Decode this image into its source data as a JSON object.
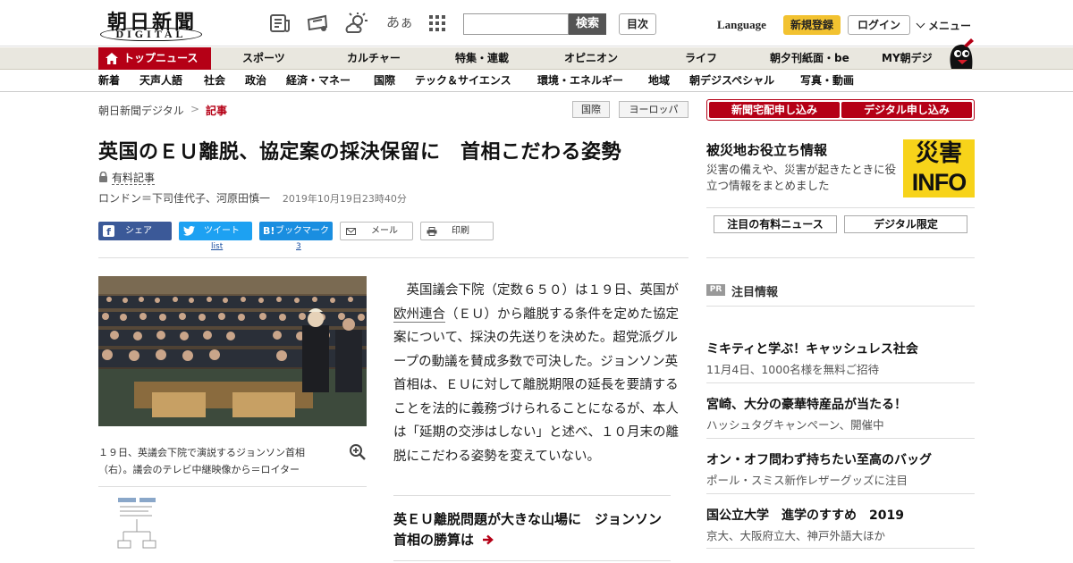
{
  "header": {
    "logo_main": "朝日新聞",
    "logo_sub": "DIGITAL",
    "font_size_label": "あぁ",
    "search_button": "検索",
    "toc_button": "目次",
    "language": "Language",
    "register": "新規登録",
    "login": "ログイン",
    "menu": "メニュー"
  },
  "nav_primary": {
    "active": "トップニュース",
    "items": [
      "スポーツ",
      "カルチャー",
      "特集・連載",
      "オピニオン",
      "ライフ",
      "朝夕刊紙面・be",
      "MY朝デジ"
    ]
  },
  "nav_secondary": {
    "items": [
      "新着",
      "天声人語",
      "社会",
      "政治",
      "経済・マネー",
      "国際",
      "テック＆サイエンス",
      "環境・エネルギー",
      "地域",
      "朝デジスペシャル",
      "写真・動画"
    ]
  },
  "breadcrumb": {
    "home": "朝日新聞デジタル",
    "separator": ">",
    "current": "記事"
  },
  "tags": [
    "国際",
    "ヨーロッパ"
  ],
  "article": {
    "title": "英国のＥＵ離脱、協定案の採決保留に　首相こだわる姿勢",
    "paid_label": "有料記事",
    "byline": "ロンドン＝下司佳代子、河原田慎一",
    "timestamp": "2019年10月19日23時40分",
    "share": {
      "facebook": "シェア",
      "twitter": "ツイート",
      "twitter_count": "list",
      "hatena": "ブックマーク",
      "hatena_count": "3",
      "mail": "メール",
      "print": "印刷"
    },
    "photo_caption": "１９日、英議会下院で演説するジョンソン首相（右）。議会のテレビ中継映像から＝ロイター",
    "body_before_link": "英国議会下院（定数６５０）は１９日、英国が",
    "body_link": "欧州連合",
    "body_after_link": "（ＥＵ）から離脱する条件を定めた協定案について、採決の先送りを決めた。超党派グループの動議を賛成多数で可決した。ジョンソン英首相は、ＥＵに対して離脱期限の延長を要請することを法的に義務づけられることになるが、本人は「延期の交渉はしない」と述べ、１０月末の離脱にこだわる姿勢を変えていない。",
    "related_title": "英ＥＵ離脱問題が大きな山場に　ジョンソン首相の勝算は"
  },
  "sidebar": {
    "delivery_button": "新聞宅配申し込み",
    "digital_button": "デジタル申し込み",
    "disaster_title": "被災地お役立ち情報",
    "disaster_desc": "災害の備えや、災害が起きたときに役立つ情報をまとめました",
    "disaster_banner_top": "災害",
    "disaster_banner_bottom": "INFO",
    "paid_news_button": "注目の有料ニュース",
    "digital_only_button": "デジタル限定",
    "pr_badge": "PR",
    "pr_heading": "注目情報",
    "pr_items": [
      {
        "title": "ミキティと学ぶ！キャッシュレス社会",
        "sub": "11月4日、1000名様を無料ご招待"
      },
      {
        "title": "宮崎、大分の豪華特産品が当たる！",
        "sub": "ハッシュタグキャンペーン、開催中"
      },
      {
        "title": "オン・オフ問わず持ちたい至高のバッグ",
        "sub": "ポール・スミス新作レザーグッズに注目"
      },
      {
        "title": "国公立大学　進学のすすめ　2019",
        "sub": "京大、大阪府立大、神戸外語大ほか"
      }
    ]
  },
  "colors": {
    "brand_red": "#b50016",
    "nav_bg": "#e9e7df",
    "facebook": "#3b5998",
    "twitter": "#1da1f2",
    "hatena": "#1a8ee0",
    "register_yellow": "#f2c230",
    "disaster_yellow": "#f7d31a"
  }
}
